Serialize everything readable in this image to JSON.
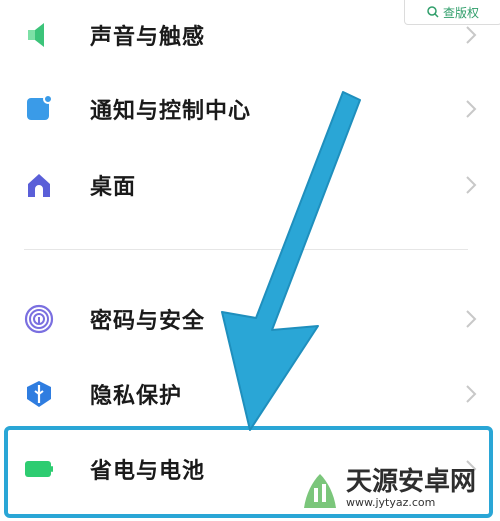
{
  "watermark_top": {
    "label": "查版权"
  },
  "settings": {
    "items": [
      {
        "label": "声音与触感",
        "icon": "speaker-icon",
        "color": "#3cc47a"
      },
      {
        "label": "通知与控制中心",
        "icon": "notification-icon",
        "color": "#3a9be8"
      },
      {
        "label": "桌面",
        "icon": "home-icon",
        "color": "#5a5fd8"
      },
      {
        "label": "密码与安全",
        "icon": "fingerprint-icon",
        "color": "#7a6fe0"
      },
      {
        "label": "隐私保护",
        "icon": "privacy-shield-icon",
        "color": "#2f7de0"
      },
      {
        "label": "省电与电池",
        "icon": "battery-icon",
        "color": "#2ecc71"
      }
    ]
  },
  "overlay": {
    "highlight_color": "#2aa6d6",
    "arrow_color": "#2aa6d6"
  },
  "watermark_bottom": {
    "brand": "天源安卓网",
    "url": "www.jytyaz.com"
  }
}
